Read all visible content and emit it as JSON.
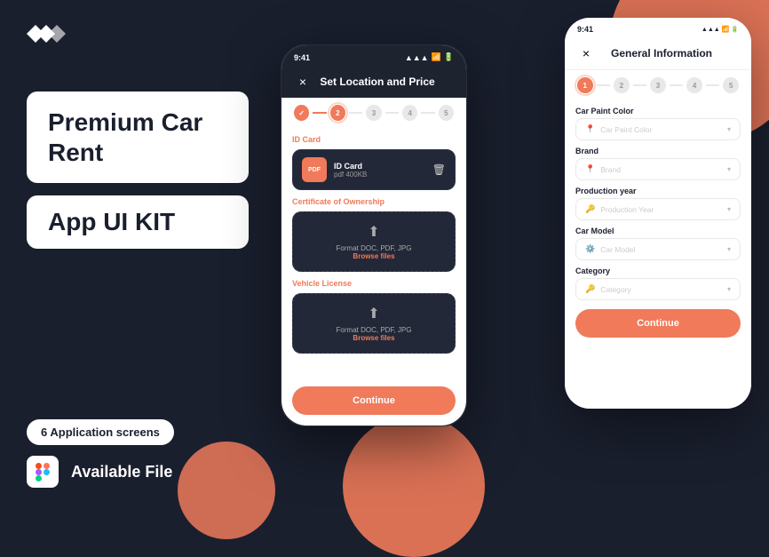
{
  "brand": {
    "logo_alt": "Logo",
    "title_line1": "Premium Car Rent",
    "title_line2": "App UI KIT",
    "screens_badge": "6 Application screens",
    "available_label": "Available File"
  },
  "phone_back": {
    "time": "9:41",
    "header_title": "Set Location and Price",
    "close_label": "×",
    "stepper": [
      {
        "num": "✓",
        "state": "done"
      },
      {
        "num": "2",
        "state": "active"
      },
      {
        "num": "3",
        "state": "inactive"
      },
      {
        "num": "4",
        "state": "inactive"
      },
      {
        "num": "5",
        "state": "inactive"
      }
    ],
    "id_card_section": "ID Card",
    "file_name": "ID Card",
    "file_size": "pdf 400KB",
    "certificate_section": "Certificate of Ownership",
    "upload1_text": "Format DOC, PDF, JPG",
    "browse1_label": "Browse files",
    "vehicle_section": "Vehicle License",
    "upload2_text": "Format DOC, PDF, JPG",
    "browse2_label": "Browse files",
    "continue_label": "Continue"
  },
  "phone_front": {
    "time": "9:41",
    "header_title": "General Information",
    "close_label": "×",
    "stepper": [
      {
        "num": "1",
        "state": "active"
      },
      {
        "num": "2",
        "state": "inactive"
      },
      {
        "num": "3",
        "state": "inactive"
      },
      {
        "num": "4",
        "state": "inactive"
      },
      {
        "num": "5",
        "state": "inactive"
      }
    ],
    "fields": [
      {
        "label": "Car Paint Color",
        "placeholder": "Car Paint Color",
        "icon": "🎨"
      },
      {
        "label": "Brand",
        "placeholder": "Brand",
        "icon": "📍"
      },
      {
        "label": "Production year",
        "placeholder": "Production Year",
        "icon": "🔑"
      },
      {
        "label": "Car Model",
        "placeholder": "Car Model",
        "icon": "⚙️"
      },
      {
        "label": "Category",
        "placeholder": "Category",
        "icon": "🔑"
      }
    ],
    "continue_label": "Continue"
  },
  "colors": {
    "accent": "#f07a5a",
    "dark_bg": "#1a1f2e",
    "white": "#ffffff"
  }
}
